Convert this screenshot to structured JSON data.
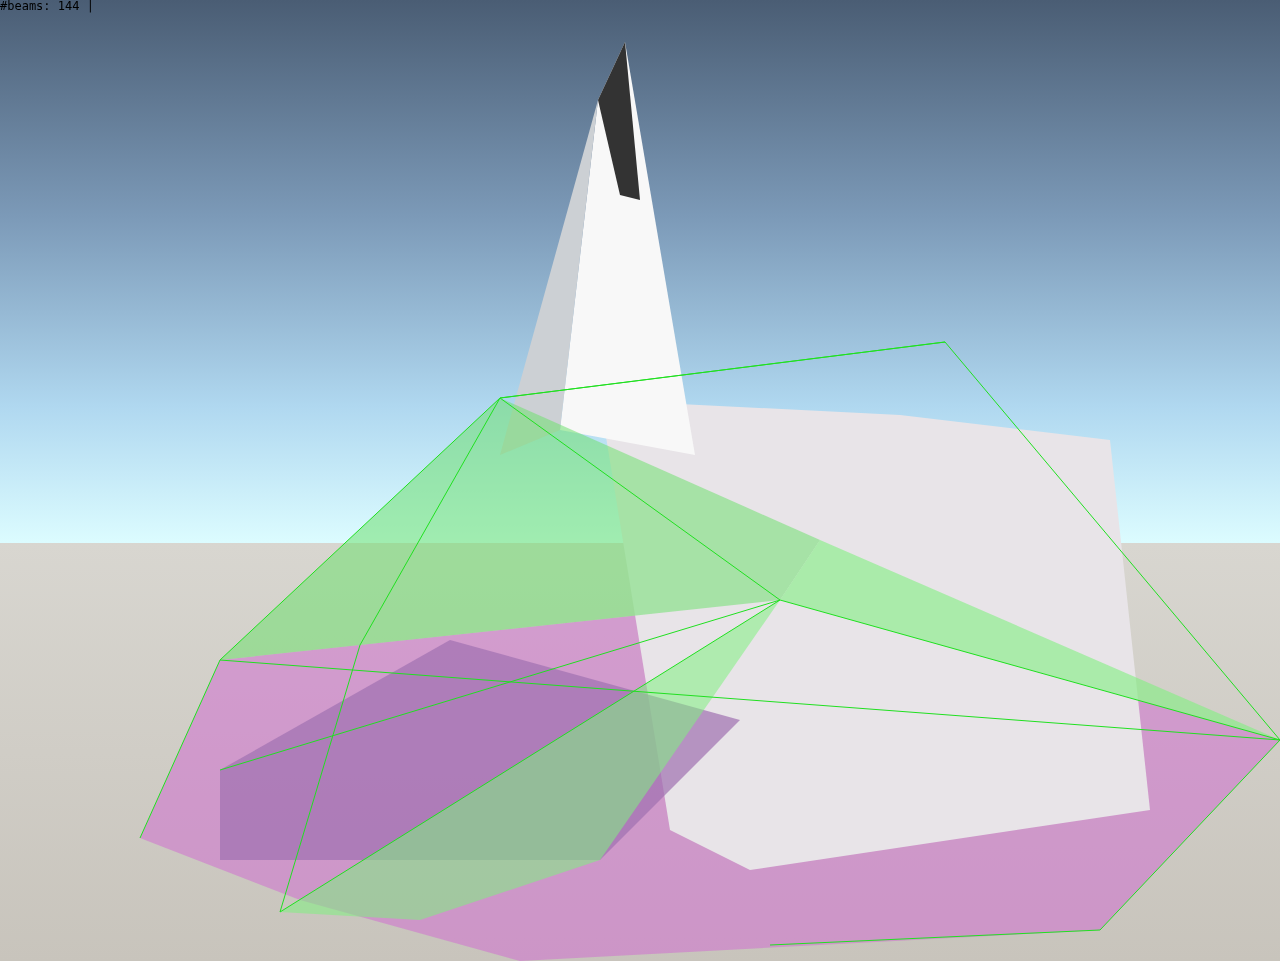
{
  "overlay": {
    "text": "#beams: 144 |"
  }
}
